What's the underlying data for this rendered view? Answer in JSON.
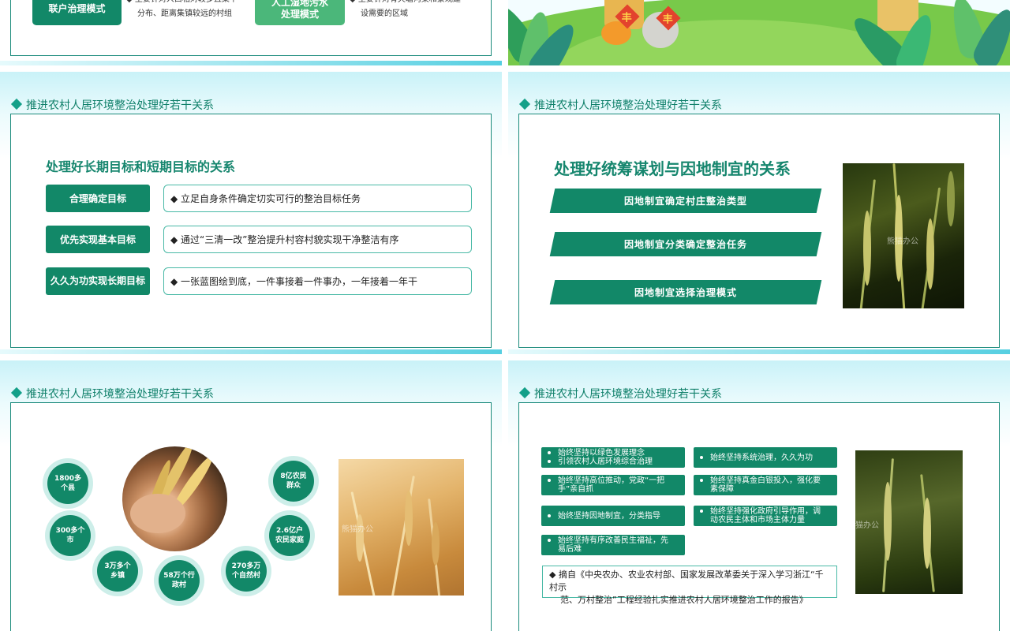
{
  "slide1": {
    "mode_left": "联户治理模式",
    "desc_left_1": "◆ 主要针对人口相对较多且集中",
    "desc_left_2": "分布、距离集镇较远的村组",
    "mode_right_1": "人工湿地污水",
    "mode_right_2": "处理模式",
    "desc_right_1": "◆ 主要针对有天塘沟渠和景观建",
    "desc_right_2": "设需要的区域"
  },
  "slide2": {
    "sign_char": "丰"
  },
  "common": {
    "header": "推进农村人居环境整治处理好若干关系",
    "watermark": "熊猫办公"
  },
  "slide3": {
    "title": "处理好长期目标和短期目标的关系",
    "rows": [
      {
        "label": "合理确定目标",
        "text": "◆ 立足自身条件确定切实可行的整治目标任务"
      },
      {
        "label": "优先实现基本目标",
        "text": "◆ 通过“三清一改”整治提升村容村貌实现干净整洁有序"
      },
      {
        "label": "久久为功实现长期目标",
        "text": "◆ 一张蓝图绘到底，一件事接着一件事办，一年接着一年干"
      }
    ]
  },
  "slide4": {
    "title": "处理好统筹谋划与因地制宜的关系",
    "items": [
      "因地制宜确定村庄整治类型",
      "因地制宜分类确定整治任务",
      "因地制宜选择治理模式"
    ]
  },
  "slide5": {
    "stats": [
      "1800多个县",
      "300多个市",
      "3万多个乡镇",
      "58万个行政村",
      "270多万个自然村",
      "2.6亿户农民家庭",
      "8亿农民群众"
    ]
  },
  "slide6": {
    "left": [
      [
        "始终坚持以绿色发展理念",
        "引领农村人居环境综合治理"
      ],
      [
        "始终坚持高位推动，党政“一把",
        "手”亲自抓"
      ],
      [
        "始终坚持因地制宜，分类指导"
      ],
      [
        "始终坚持有序改善民生福祉，先",
        "易后难"
      ]
    ],
    "right": [
      [
        "始终坚持系统治理，久久为功"
      ],
      [
        "始终坚持真金白银投入，强化要",
        "素保障"
      ],
      [
        "始终坚持强化政府引导作用，调",
        "动农民主体和市场主体力量"
      ]
    ],
    "quote_1": "◆ 摘自《中央农办、农业农村部、国家发展改革委关于深入学习浙江“千村示",
    "quote_2": "范、万村整治”工程经验扎实推进农村人居环境整治工作的报告》"
  }
}
